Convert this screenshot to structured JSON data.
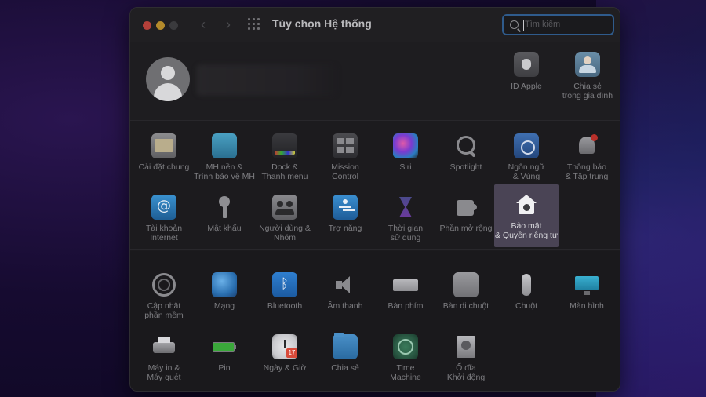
{
  "window": {
    "title": "Tùy chọn Hệ thống",
    "search_placeholder": "Tìm kiếm"
  },
  "account": {
    "items": [
      {
        "label": "ID Apple",
        "icon": "apple-id-icon"
      },
      {
        "label": "Chia sẻ\ntrong gia đình",
        "icon": "family-sharing-icon"
      }
    ]
  },
  "prefs": [
    {
      "label": "Cài đặt chung",
      "icon": "general-icon",
      "cls": "ic-general"
    },
    {
      "label": "MH nền &\nTrình bảo vệ MH",
      "icon": "desktop-screensaver-icon",
      "cls": "ic-desktop"
    },
    {
      "label": "Dock &\nThanh menu",
      "icon": "dock-menubar-icon",
      "cls": "ic-dock"
    },
    {
      "label": "Mission\nControl",
      "icon": "mission-control-icon",
      "cls": "ic-mission"
    },
    {
      "label": "Siri",
      "icon": "siri-icon",
      "cls": "ic-siri"
    },
    {
      "label": "Spotlight",
      "icon": "spotlight-icon",
      "cls": "ic-spotlight"
    },
    {
      "label": "Ngôn ngữ\n& Vùng",
      "icon": "language-region-icon",
      "cls": "ic-language"
    },
    {
      "label": "Thông báo\n& Tập trung",
      "icon": "notifications-icon",
      "cls": "ic-notify"
    },
    {
      "label": "Tài khoản\nInternet",
      "icon": "internet-accounts-icon",
      "cls": "ic-internet"
    },
    {
      "label": "Mật khẩu",
      "icon": "passwords-icon",
      "cls": "ic-password"
    },
    {
      "label": "Người dùng &\nNhóm",
      "icon": "users-groups-icon",
      "cls": "ic-users"
    },
    {
      "label": "Trợ năng",
      "icon": "accessibility-icon",
      "cls": "ic-access"
    },
    {
      "label": "Thời gian\nsử dụng",
      "icon": "screen-time-icon",
      "cls": "ic-screentime"
    },
    {
      "label": "Phần mở rộng",
      "icon": "extensions-icon",
      "cls": "ic-ext"
    },
    {
      "label": "Bảo mật\n& Quyền riêng tư",
      "icon": "security-privacy-icon",
      "cls": "ic-security",
      "selected": true
    },
    {
      "label": "Cập nhật\nphần mềm",
      "icon": "software-update-icon",
      "cls": "ic-update"
    },
    {
      "label": "Mạng",
      "icon": "network-icon",
      "cls": "ic-network"
    },
    {
      "label": "Bluetooth",
      "icon": "bluetooth-icon",
      "cls": "ic-bluetooth"
    },
    {
      "label": "Âm thanh",
      "icon": "sound-icon",
      "cls": "ic-sound"
    },
    {
      "label": "Bàn phím",
      "icon": "keyboard-icon",
      "cls": "ic-keyboard"
    },
    {
      "label": "Bàn di chuột",
      "icon": "trackpad-icon",
      "cls": "ic-trackpad"
    },
    {
      "label": "Chuột",
      "icon": "mouse-icon",
      "cls": "ic-mouse"
    },
    {
      "label": "Màn hình",
      "icon": "displays-icon",
      "cls": "ic-display"
    },
    {
      "label": "Máy in &\nMáy quét",
      "icon": "printers-scanners-icon",
      "cls": "ic-printer"
    },
    {
      "label": "Pin",
      "icon": "battery-icon",
      "cls": "ic-battery"
    },
    {
      "label": "Ngày & Giờ",
      "icon": "date-time-icon",
      "cls": "ic-datetime"
    },
    {
      "label": "Chia sẻ",
      "icon": "sharing-icon",
      "cls": "ic-sharing"
    },
    {
      "label": "Time\nMachine",
      "icon": "time-machine-icon",
      "cls": "ic-timemachine"
    },
    {
      "label": "Ổ đĩa\nKhởi động",
      "icon": "startup-disk-icon",
      "cls": "ic-startup"
    }
  ]
}
